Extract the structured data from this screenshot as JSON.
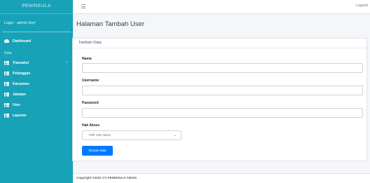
{
  "sidebar": {
    "brand": "PENINSULA",
    "login_info": "Login : admin boy!",
    "dashboard": "Dashboard",
    "section_header": "Data",
    "items": [
      {
        "label": "Transaksi",
        "icon": "grid-icon",
        "has_chevron": true
      },
      {
        "label": "Pelanggan",
        "icon": "grid-icon"
      },
      {
        "label": "Karyawan",
        "icon": "grid-icon"
      },
      {
        "label": "Jabatan",
        "icon": "grid-icon"
      },
      {
        "label": "User",
        "icon": "grid-icon"
      },
      {
        "label": "Laporan",
        "icon": "grid-icon"
      }
    ],
    "chevron": "‹"
  },
  "topbar": {
    "menu_icon": "hamburger-icon",
    "logout": "Logout"
  },
  "page": {
    "title": "Halaman Tambah User"
  },
  "form": {
    "card_title": "Tambah Data",
    "fields": {
      "nama": {
        "label": "Nama",
        "value": ""
      },
      "username": {
        "label": "Username",
        "value": ""
      },
      "password": {
        "label": "Password",
        "value": ""
      }
    },
    "hak_akses": {
      "label": "Hak Akses",
      "selected": "Pilih Hak Akses"
    },
    "submit": "Simpan data"
  },
  "footer": {
    "text": "Copyright ©2021 CV PENINSULA ABADI"
  },
  "colors": {
    "sidebar": "#17a2b8",
    "primary_button": "#007bff"
  }
}
